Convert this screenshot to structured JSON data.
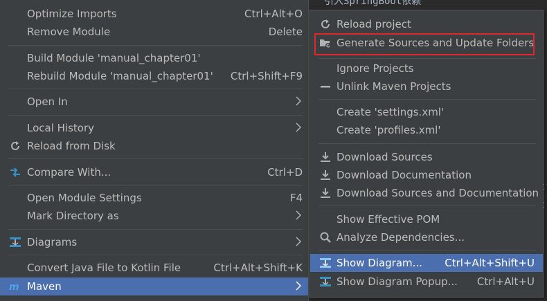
{
  "editor": {
    "top_code": "引入SpringBoot依赖",
    "edge_chars": [
      "t",
      "t"
    ]
  },
  "context_menu": {
    "items": [
      {
        "label": "Optimize Imports",
        "shortcut": "Ctrl+Alt+O"
      },
      {
        "label": "Remove Module",
        "shortcut": "Delete"
      },
      {
        "label": "Build Module 'manual_chapter01'",
        "shortcut": ""
      },
      {
        "label": "Rebuild Module 'manual_chapter01'",
        "shortcut": "Ctrl+Shift+F9"
      },
      {
        "label": "Open In",
        "shortcut": ""
      },
      {
        "label": "Local History",
        "shortcut": ""
      },
      {
        "label": "Reload from Disk",
        "shortcut": ""
      },
      {
        "label": "Compare With...",
        "shortcut": "Ctrl+D"
      },
      {
        "label": "Open Module Settings",
        "shortcut": "F4"
      },
      {
        "label": "Mark Directory as",
        "shortcut": ""
      },
      {
        "label": "Diagrams",
        "shortcut": ""
      },
      {
        "label": "Convert Java File to Kotlin File",
        "shortcut": "Ctrl+Alt+Shift+K"
      },
      {
        "label": "Maven",
        "shortcut": ""
      }
    ]
  },
  "maven_submenu": {
    "items": [
      {
        "label": "Reload project",
        "shortcut": ""
      },
      {
        "label": "Generate Sources and Update Folders",
        "shortcut": ""
      },
      {
        "label": "Ignore Projects",
        "shortcut": ""
      },
      {
        "label": "Unlink Maven Projects",
        "shortcut": ""
      },
      {
        "label": "Create 'settings.xml'",
        "shortcut": ""
      },
      {
        "label": "Create 'profiles.xml'",
        "shortcut": ""
      },
      {
        "label": "Download Sources",
        "shortcut": ""
      },
      {
        "label": "Download Documentation",
        "shortcut": ""
      },
      {
        "label": "Download Sources and Documentation",
        "shortcut": ""
      },
      {
        "label": "Show Effective POM",
        "shortcut": ""
      },
      {
        "label": "Analyze Dependencies...",
        "shortcut": ""
      },
      {
        "label": "Show Diagram...",
        "shortcut": "Ctrl+Alt+Shift+U"
      },
      {
        "label": "Show Diagram Popup...",
        "shortcut": "Ctrl+Alt+U"
      }
    ]
  },
  "colors": {
    "menu_bg": "#3c3f41",
    "selection": "#4b6eaf",
    "text": "#bbbbbb",
    "highlight_border": "#e0282b",
    "icon_blue": "#3592c4",
    "icon_gray": "#afb1b3"
  },
  "icons": {
    "reload": "reload-icon",
    "compare": "compare-arrows-icon",
    "diagram": "diagram-icon",
    "maven": "maven-icon",
    "folder_gen": "folder-generate-icon",
    "minus": "minus-icon",
    "download": "download-icon",
    "search": "search-icon",
    "submenu_arrow": "chevron-right-icon"
  }
}
